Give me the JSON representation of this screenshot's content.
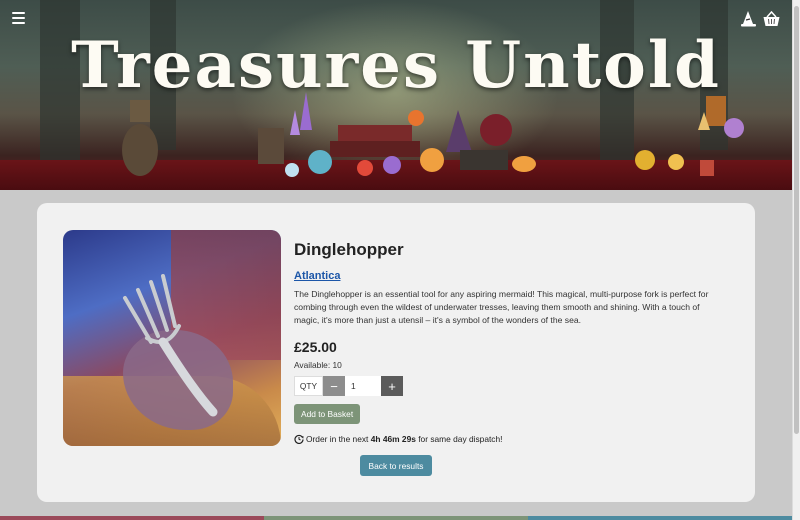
{
  "header": {
    "site_title": "Treasures Untold",
    "icons": [
      "hamburger-menu-icon",
      "wizard-hat-icon",
      "basket-icon"
    ]
  },
  "product": {
    "name": "Dinglehopper",
    "brand": "Atlantica",
    "description": "The Dinglehopper is an essential tool for any aspiring mermaid! This magical, multi-purpose fork is perfect for combing through even the wildest of underwater tresses, leaving them smooth and shining. With a touch of magic, it's more than just a utensil – it's a symbol of the wonders of the sea.",
    "price": "£25.00",
    "availability": "Available: 10",
    "qty_label": "QTY",
    "qty_value": "1",
    "minus_label": "−",
    "plus_label": "+",
    "add_button": "Add to Basket"
  },
  "dispatch": {
    "prefix": "Order in the next",
    "countdown": "4h 46m 29s",
    "suffix": "for same day dispatch!"
  },
  "back_button": "Back to results",
  "colors": {
    "add_button": "#7d9478",
    "back_button": "#4d8ba0",
    "brand_link": "#1c56a8",
    "stripe_red": "#9b4a5a",
    "stripe_green": "#7d9478",
    "stripe_blue": "#4d8ba0"
  }
}
